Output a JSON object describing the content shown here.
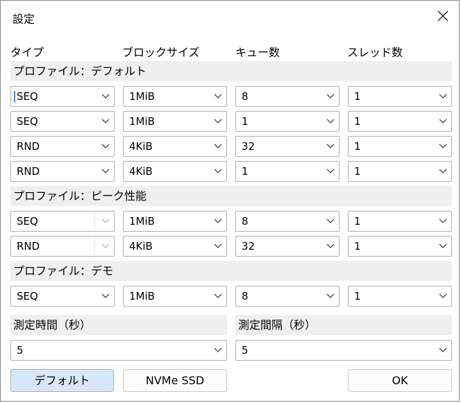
{
  "dialog": {
    "title": "設定"
  },
  "headers": {
    "type": "タイプ",
    "block_size": "ブロックサイズ",
    "queues": "キュー数",
    "threads": "スレッド数"
  },
  "sections": {
    "default": "プロファイル：デフォルト",
    "peak": "プロファイル：ピーク性能",
    "demo": "プロファイル：デモ"
  },
  "rows": {
    "default": [
      {
        "type": "SEQ",
        "block": "1MiB",
        "queue": "8",
        "thread": "1"
      },
      {
        "type": "SEQ",
        "block": "1MiB",
        "queue": "1",
        "thread": "1"
      },
      {
        "type": "RND",
        "block": "4KiB",
        "queue": "32",
        "thread": "1"
      },
      {
        "type": "RND",
        "block": "4KiB",
        "queue": "1",
        "thread": "1"
      }
    ],
    "peak": [
      {
        "type": "SEQ",
        "block": "1MiB",
        "queue": "8",
        "thread": "1"
      },
      {
        "type": "RND",
        "block": "4KiB",
        "queue": "32",
        "thread": "1"
      }
    ],
    "demo": [
      {
        "type": "SEQ",
        "block": "1MiB",
        "queue": "8",
        "thread": "1"
      }
    ]
  },
  "measure": {
    "time_label": "測定時間（秒）",
    "time_value": "5",
    "interval_label": "測定間隔（秒）",
    "interval_value": "5"
  },
  "buttons": {
    "default": "デフォルト",
    "nvme": "NVMe SSD",
    "ok": "OK"
  },
  "icons": {
    "close": "close-icon",
    "dropdown": "chevron-down-icon"
  }
}
